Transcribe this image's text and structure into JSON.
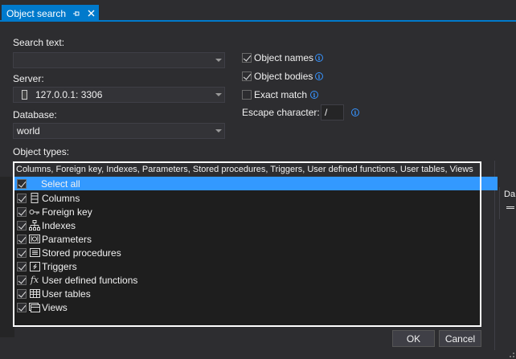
{
  "tab": {
    "title": "Object search"
  },
  "search_text": {
    "label": "Search text:",
    "value": ""
  },
  "server": {
    "label": "Server:",
    "value": "127.0.0.1: 3306"
  },
  "database": {
    "label": "Database:",
    "value": "world"
  },
  "options": {
    "object_names": {
      "label": "Object names",
      "checked": true
    },
    "object_bodies": {
      "label": "Object bodies",
      "checked": true
    },
    "exact_match": {
      "label": "Exact match",
      "checked": false
    },
    "escape_label": "Escape character:",
    "escape_value": "/"
  },
  "object_types": {
    "label": "Object types:",
    "value": "Columns, Foreign key, Indexes, Parameters, Stored procedures, Triggers, User defined functions, User tables, Views",
    "items": [
      {
        "label": "Select all",
        "icon": "none",
        "checked": true,
        "selected": true
      },
      {
        "label": "Columns",
        "icon": "column-icon",
        "checked": true
      },
      {
        "label": "Foreign key",
        "icon": "key-icon",
        "checked": true
      },
      {
        "label": "Indexes",
        "icon": "index-icon",
        "checked": true
      },
      {
        "label": "Parameters",
        "icon": "parameters-icon",
        "checked": true
      },
      {
        "label": "Stored procedures",
        "icon": "procedure-icon",
        "checked": true
      },
      {
        "label": "Triggers",
        "icon": "trigger-icon",
        "checked": true
      },
      {
        "label": "User defined functions",
        "icon": "function-icon",
        "checked": true
      },
      {
        "label": "User tables",
        "icon": "table-icon",
        "checked": true
      },
      {
        "label": "Views",
        "icon": "view-icon",
        "checked": true
      }
    ]
  },
  "right_panel": {
    "header": "Da"
  },
  "buttons": {
    "ok": "OK",
    "cancel": "Cancel"
  },
  "colors": {
    "accent": "#007acc",
    "selection": "#3399ff",
    "info": "#3794ff"
  }
}
